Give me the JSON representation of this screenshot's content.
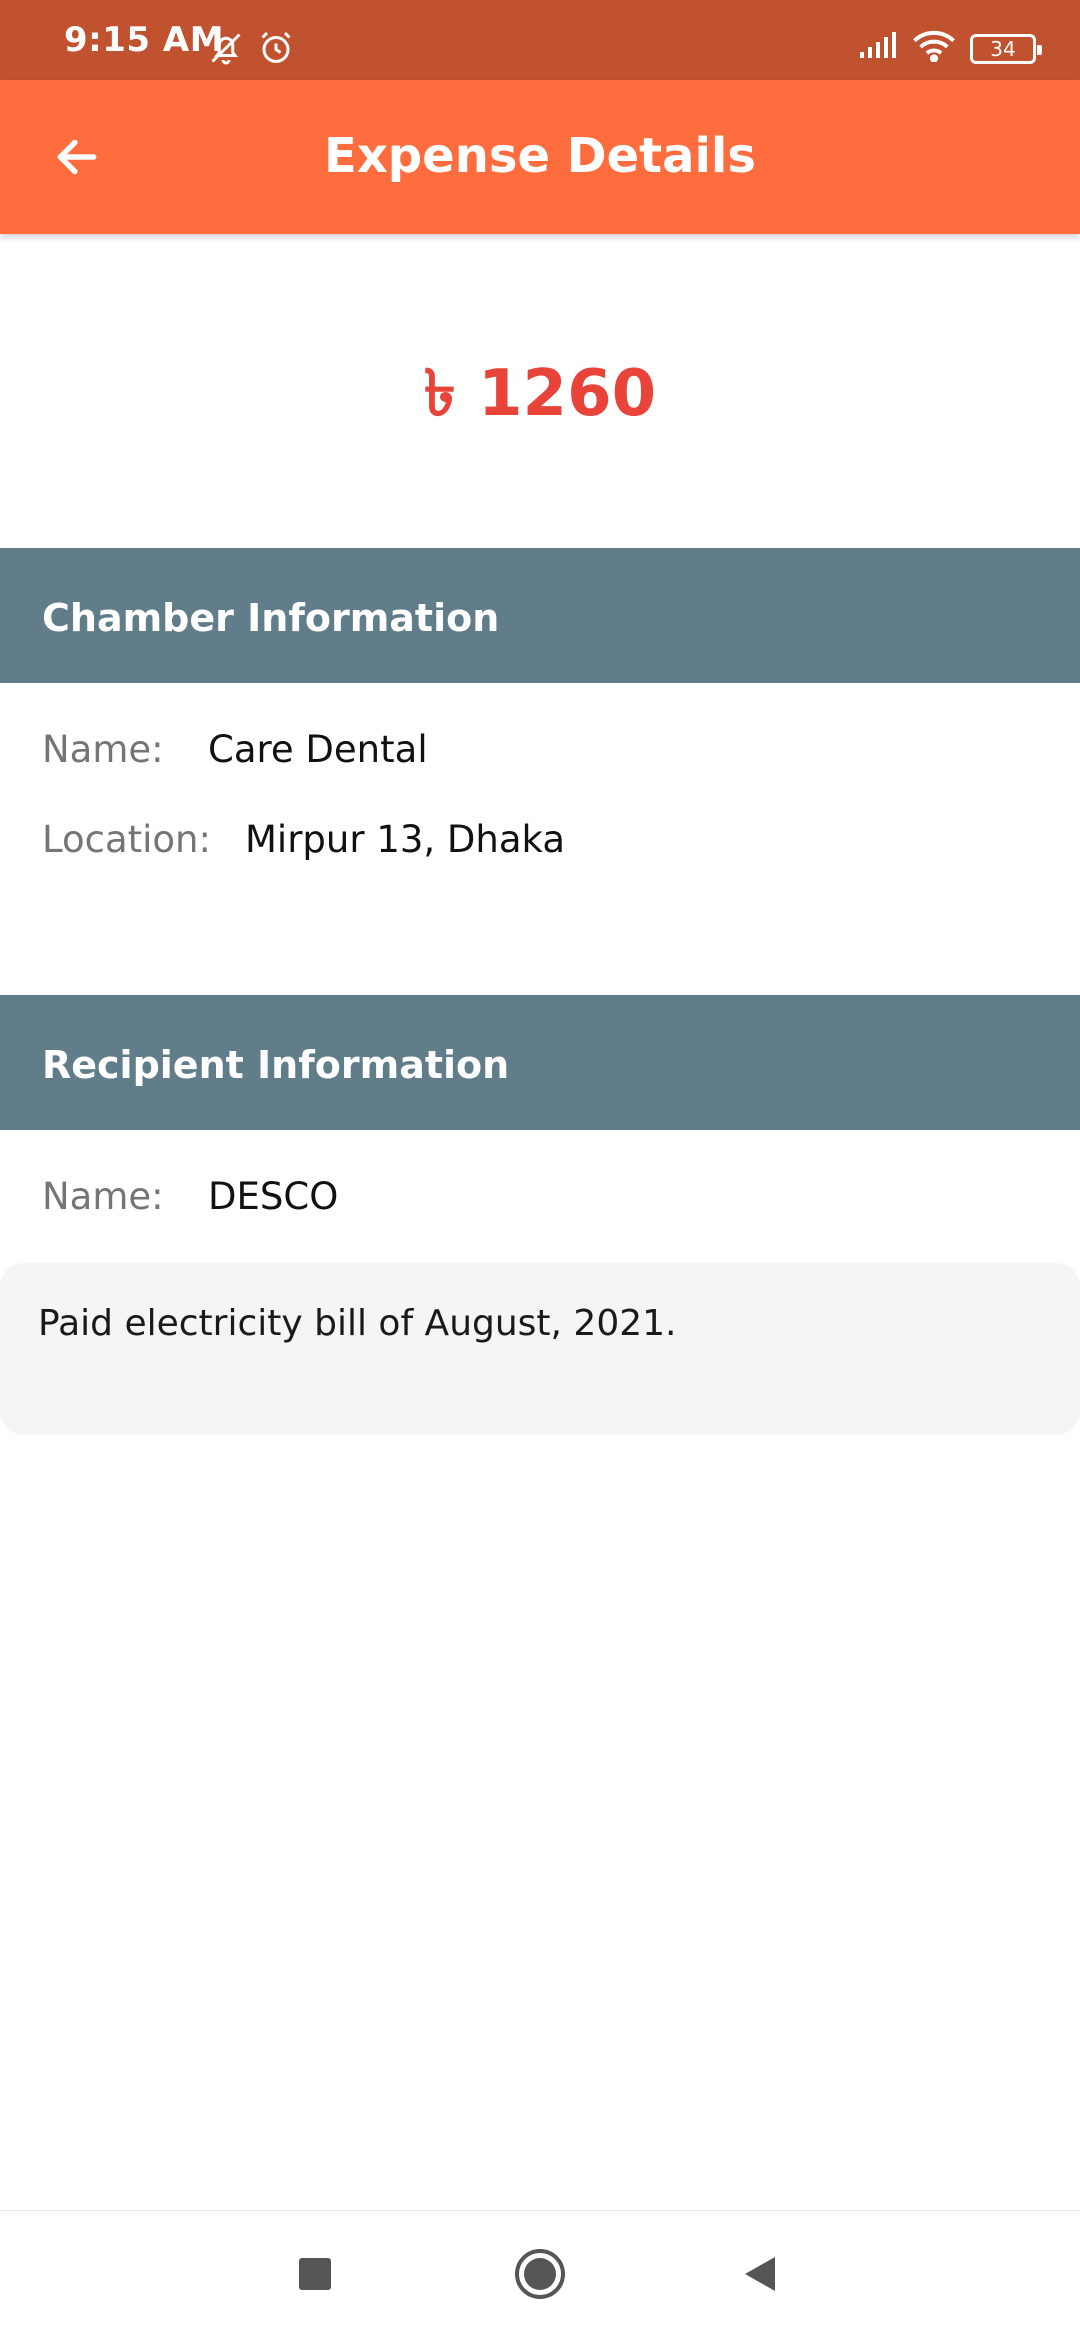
{
  "status_bar": {
    "time": "9:15 AM",
    "battery_level": "34",
    "icons": [
      "mute-icon",
      "alarm-icon",
      "signal-icon",
      "wifi-icon",
      "battery-icon"
    ]
  },
  "app_bar": {
    "title": "Expense Details",
    "back_icon": "arrow-left-icon"
  },
  "expense": {
    "amount": "৳ 1260"
  },
  "chamber": {
    "header": "Chamber Information",
    "name_label": "Name:",
    "name_value": "Care Dental",
    "location_label": "Location:",
    "location_value": "Mirpur 13, Dhaka"
  },
  "recipient": {
    "header": "Recipient Information",
    "name_label": "Name:",
    "name_value": "DESCO"
  },
  "note": {
    "text": "Paid electricity bill of August, 2021."
  },
  "nav_bar": {
    "icons": [
      "recents-square-icon",
      "home-circle-icon",
      "back-triangle-icon"
    ]
  },
  "colors": {
    "status_bar": "#c05230",
    "app_bar": "#ff6d3f",
    "amount": "#e8443a",
    "section_header": "#627d8a",
    "note_background": "#f5f5f5"
  }
}
